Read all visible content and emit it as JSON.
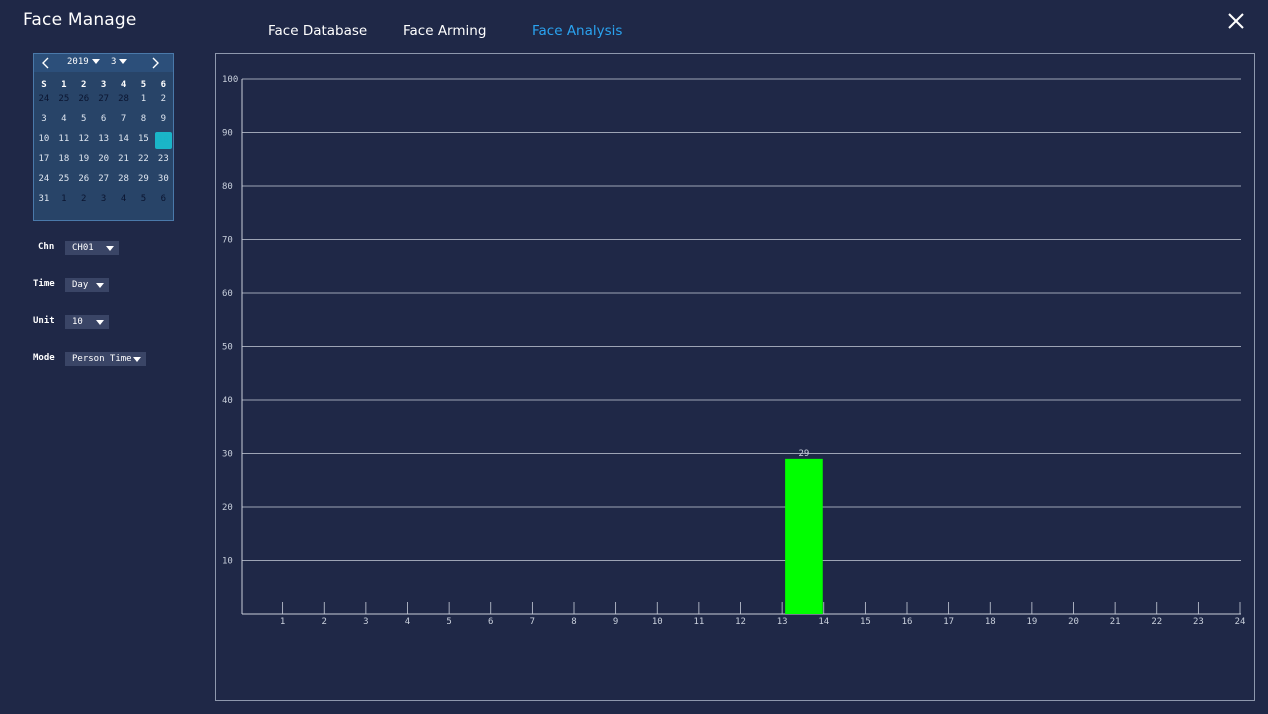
{
  "app": {
    "title": "Face Manage"
  },
  "tabs": [
    {
      "label": "Face Database",
      "active": false
    },
    {
      "label": "Face Arming",
      "active": false
    },
    {
      "label": "Face Analysis",
      "active": true
    }
  ],
  "calendar": {
    "year": "2019",
    "month": "3",
    "weekdays": [
      "S",
      "1",
      "2",
      "3",
      "4",
      "5",
      "6"
    ],
    "selected_day": "16",
    "weeks": [
      [
        {
          "d": "24",
          "o": true
        },
        {
          "d": "25",
          "o": true
        },
        {
          "d": "26",
          "o": true
        },
        {
          "d": "27",
          "o": true
        },
        {
          "d": "28",
          "o": true
        },
        {
          "d": "1",
          "o": false
        },
        {
          "d": "2",
          "o": false
        }
      ],
      [
        {
          "d": "3",
          "o": false
        },
        {
          "d": "4",
          "o": false
        },
        {
          "d": "5",
          "o": false
        },
        {
          "d": "6",
          "o": false
        },
        {
          "d": "7",
          "o": false
        },
        {
          "d": "8",
          "o": false
        },
        {
          "d": "9",
          "o": false
        }
      ],
      [
        {
          "d": "10",
          "o": false
        },
        {
          "d": "11",
          "o": false
        },
        {
          "d": "12",
          "o": false
        },
        {
          "d": "13",
          "o": false
        },
        {
          "d": "14",
          "o": false
        },
        {
          "d": "15",
          "o": false
        },
        {
          "d": "16",
          "o": false
        }
      ],
      [
        {
          "d": "17",
          "o": false
        },
        {
          "d": "18",
          "o": false
        },
        {
          "d": "19",
          "o": false
        },
        {
          "d": "20",
          "o": false
        },
        {
          "d": "21",
          "o": false
        },
        {
          "d": "22",
          "o": false
        },
        {
          "d": "23",
          "o": false
        }
      ],
      [
        {
          "d": "24",
          "o": false
        },
        {
          "d": "25",
          "o": false
        },
        {
          "d": "26",
          "o": false
        },
        {
          "d": "27",
          "o": false
        },
        {
          "d": "28",
          "o": false
        },
        {
          "d": "29",
          "o": false
        },
        {
          "d": "30",
          "o": false
        }
      ],
      [
        {
          "d": "31",
          "o": false
        },
        {
          "d": "1",
          "o": true
        },
        {
          "d": "2",
          "o": true
        },
        {
          "d": "3",
          "o": true
        },
        {
          "d": "4",
          "o": true
        },
        {
          "d": "5",
          "o": true
        },
        {
          "d": "6",
          "o": true
        }
      ]
    ]
  },
  "controls": {
    "chn": {
      "label": "Chn",
      "value": "CH01"
    },
    "time": {
      "label": "Time",
      "value": "Day"
    },
    "unit": {
      "label": "Unit",
      "value": "10"
    },
    "mode": {
      "label": "Mode",
      "value": "Person Time"
    }
  },
  "chart_data": {
    "type": "bar",
    "title": "",
    "xlabel": "",
    "ylabel": "",
    "x_ticks": [
      "1",
      "2",
      "3",
      "4",
      "5",
      "6",
      "7",
      "8",
      "9",
      "10",
      "11",
      "12",
      "13",
      "14",
      "15",
      "16",
      "17",
      "18",
      "19",
      "20",
      "21",
      "22",
      "23",
      "24"
    ],
    "y_ticks": [
      "10",
      "20",
      "30",
      "40",
      "50",
      "60",
      "70",
      "80",
      "90",
      "100"
    ],
    "ylim": [
      0,
      100
    ],
    "xlim": [
      0,
      24
    ],
    "grid": true,
    "bars": [
      {
        "x_start": 13,
        "x_end": 14,
        "value": 29,
        "label": "29"
      }
    ],
    "colors": {
      "bar": "#00ff00",
      "grid": "#c8ceda",
      "axis": "#c8ceda"
    }
  },
  "icons": {
    "close": "close-icon",
    "prev": "chevron-left-icon",
    "next": "chevron-right-icon"
  }
}
